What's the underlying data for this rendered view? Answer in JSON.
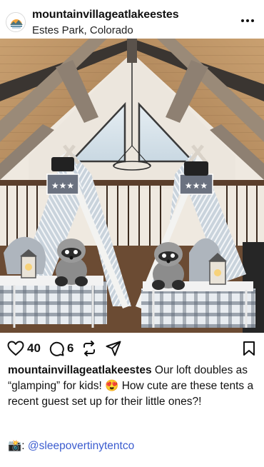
{
  "post": {
    "username": "mountainvillageatlakeestes",
    "location": "Estes Park, Colorado",
    "photo_alt": "",
    "likes": "40",
    "comments": "6",
    "caption_user": "mountainvillageatlakeestes",
    "caption_text": " Our loft doubles as “glamping” for kids! 😍 How cute are these tents a recent guest set up for their little ones?!",
    "credit_emoji": "📸:",
    "credit_mention": "@sleepovertinytentco"
  },
  "icons": {
    "avatar": "avatar-logo",
    "more": "more-horizontal-icon",
    "like": "heart-icon",
    "comment": "comment-bubble-icon",
    "repost": "repost-icon",
    "share": "send-icon",
    "save": "bookmark-icon"
  },
  "colors": {
    "text": "#111111",
    "mention": "#3b5ccf",
    "wood": "#b68a5c",
    "beam": "#8d7b69"
  }
}
